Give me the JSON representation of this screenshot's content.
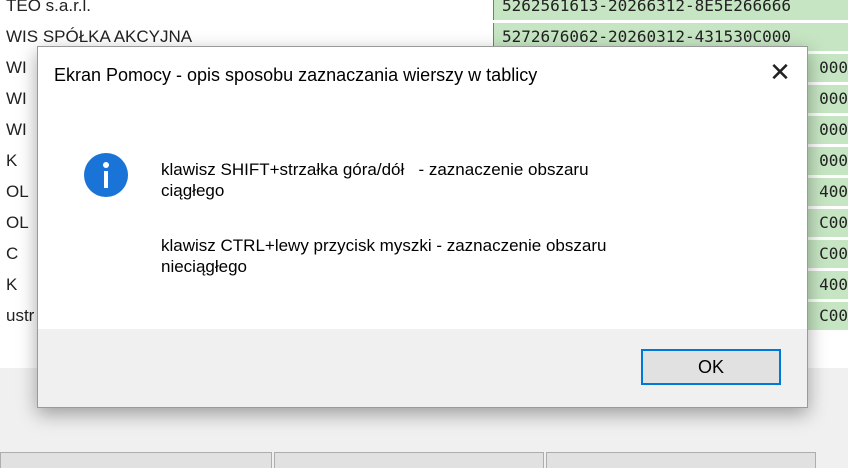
{
  "background_table": {
    "rows": [
      {
        "left": "TEO s.a.r.l.",
        "right": "5262561613-20266312-8E5E266666"
      },
      {
        "left": "WIS SPÓŁKA AKCYJNA",
        "right": "5272676062-20260312-431530C000"
      },
      {
        "left": "WI",
        "right": "000"
      },
      {
        "left": "WI",
        "right": "000"
      },
      {
        "left": "WI",
        "right": "000"
      },
      {
        "left": "K",
        "right": "000"
      },
      {
        "left": "OL",
        "right": "400"
      },
      {
        "left": "OL",
        "right": "C00"
      },
      {
        "left": "C",
        "right": "C00"
      },
      {
        "left": "K",
        "right": "400"
      },
      {
        "left": "ustr",
        "right": "C00"
      }
    ]
  },
  "dialog": {
    "title": "Ekran Pomocy - opis sposobu zaznaczania wierszy w tablicy",
    "close_glyph": "✕",
    "message_line1": "klawisz SHIFT+strzałka góra/dół   - zaznaczenie obszaru",
    "message_line1b": "ciągłego",
    "message_line2": "klawisz CTRL+lewy przycisk myszki - zaznaczenie obszaru",
    "message_line2b": "nieciągłego",
    "ok_label": "OK",
    "icon": "info-icon"
  },
  "colors": {
    "accent": "#0078d7",
    "info_icon": "#1a73d6",
    "row_highlight": "#c6e6c3"
  }
}
